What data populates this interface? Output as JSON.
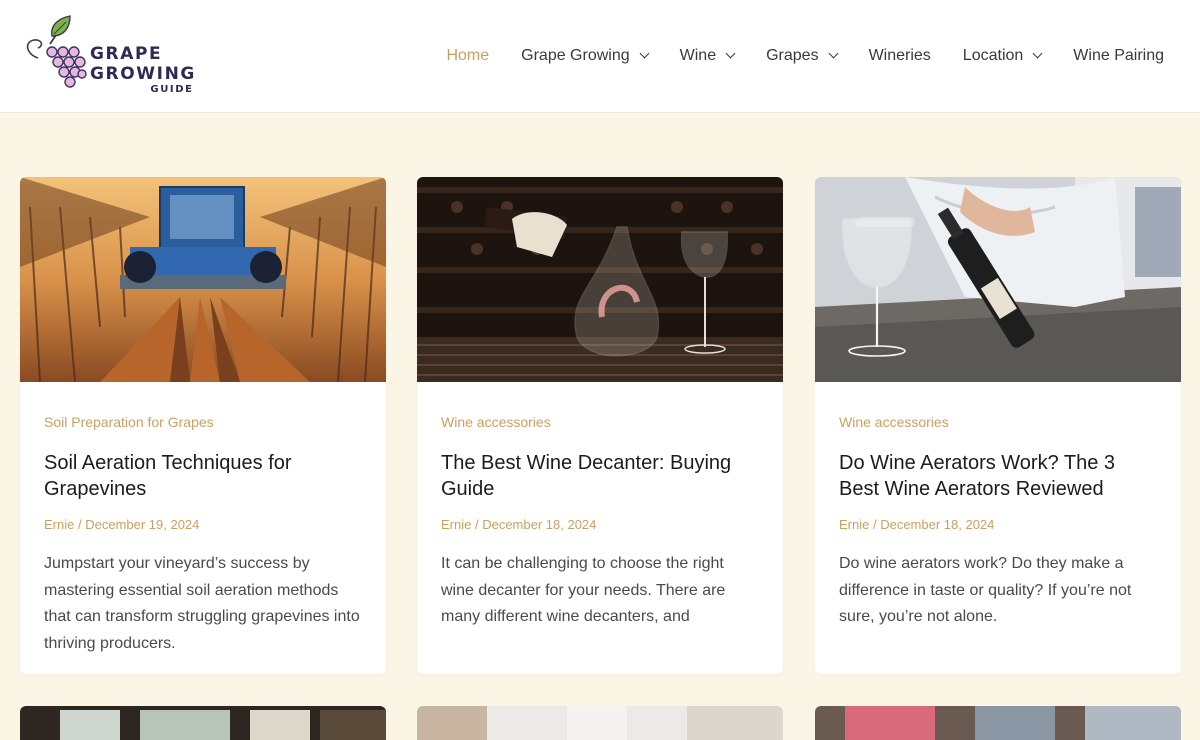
{
  "site": {
    "logo_line1": "GRAPE GROWING",
    "logo_line2": "GUIDE",
    "accent_color": "#c9a063",
    "background_color": "#fbf5e6"
  },
  "nav": {
    "items": [
      {
        "label": "Home",
        "active": true,
        "dropdown": false
      },
      {
        "label": "Grape Growing",
        "active": false,
        "dropdown": true
      },
      {
        "label": "Wine",
        "active": false,
        "dropdown": true
      },
      {
        "label": "Grapes",
        "active": false,
        "dropdown": true
      },
      {
        "label": "Wineries",
        "active": false,
        "dropdown": false
      },
      {
        "label": "Location",
        "active": false,
        "dropdown": true
      },
      {
        "label": "Wine Pairing",
        "active": false,
        "dropdown": false
      }
    ]
  },
  "posts": [
    {
      "category": "Soil Preparation for Grapes",
      "title": "Soil Aeration Techniques for Grapevines",
      "author": "Ernie",
      "separator": " / ",
      "date": "December 19, 2024",
      "excerpt": "Jumpstart your vineyard’s success by mastering essential soil aeration methods that can transform struggling grapevines into thriving producers."
    },
    {
      "category": "Wine accessories",
      "title": "The Best Wine Decanter: Buying Guide",
      "author": "Ernie",
      "separator": " / ",
      "date": "December 18, 2024",
      "excerpt": "It can be challenging to choose the right wine decanter for your needs. There are many different wine decanters, and"
    },
    {
      "category": "Wine accessories",
      "title": "Do Wine Aerators Work? The 3 Best Wine Aerators Reviewed",
      "author": "Ernie",
      "separator": " / ",
      "date": "December 18, 2024",
      "excerpt": "Do wine aerators work? Do they make a difference in taste or quality? If you’re not sure, you’re not alone."
    }
  ]
}
